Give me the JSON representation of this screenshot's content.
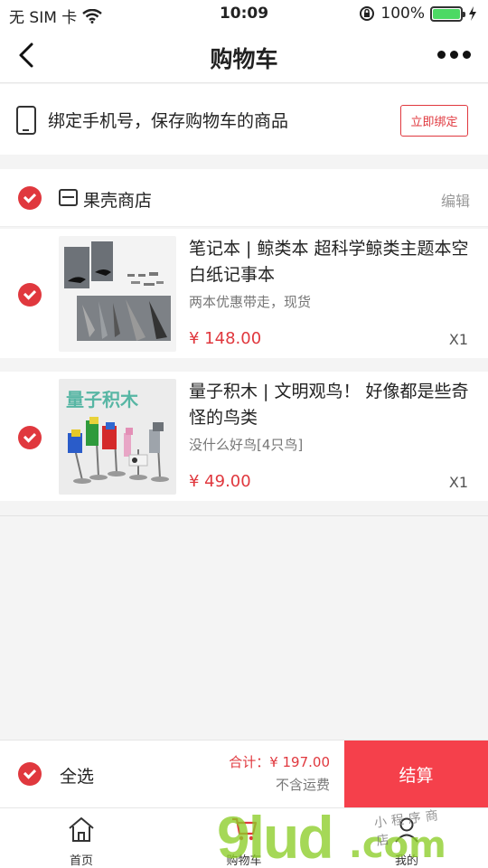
{
  "status_bar": {
    "carrier": "无 SIM 卡",
    "time": "10:09",
    "battery": "100%"
  },
  "nav": {
    "title": "购物车"
  },
  "bind_phone": {
    "text": "绑定手机号，保存购物车的商品",
    "button": "立即绑定"
  },
  "store": {
    "name": "果壳商店",
    "edit": "编辑"
  },
  "items": [
    {
      "title": "笔记本 | 鲸类本 超科学鲸类主题本空白纸记事本",
      "subtitle": "两本优惠带走，现货",
      "price": "¥ 148.00",
      "qty": "X1"
    },
    {
      "title": "量子积木 | 文明观鸟！ 好像都是些奇怪的鸟类",
      "subtitle": "没什么好鸟[4只鸟]",
      "price": "¥ 49.00",
      "qty": "X1",
      "image_text": "量子积木"
    }
  ],
  "checkout": {
    "select_all": "全选",
    "total": "合计：¥ 197.00",
    "shipping": "不含运费",
    "pay": "结算"
  },
  "tabs": [
    {
      "label": "首页"
    },
    {
      "label": "购物车"
    },
    {
      "label": "我的"
    }
  ],
  "watermark": {
    "big": "9lud",
    "cn": "小程序商店",
    "com": ".com"
  },
  "colors": {
    "accent": "#e0383e",
    "pay_button": "#f5404b",
    "watermark": "#8ccd28"
  }
}
